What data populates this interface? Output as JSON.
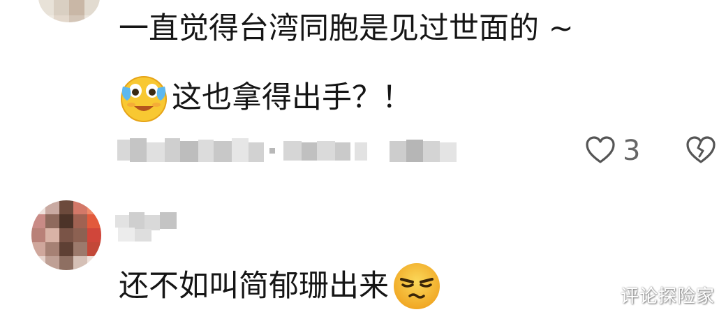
{
  "comments": [
    {
      "avatar": "pixelated-avatar",
      "text_line1": "一直觉得台湾同胞是见过世面的 ~",
      "text_line2": "这也拿得出手？！",
      "emoji_line2": "crying-laughing-emoji",
      "like_count": "3"
    },
    {
      "avatar": "pixelated-avatar",
      "text_line1": "还不如叫简郁珊出来",
      "emoji_line1": "smirking-face-emoji"
    }
  ],
  "icons": {
    "like": "heart-outline-icon",
    "dislike": "broken-heart-icon"
  },
  "watermark": "评论探险家",
  "colors": {
    "text": "#151515",
    "meta": "#666666",
    "emoji_yellow": "#f8c832",
    "emoji_orange": "#f2a21a"
  }
}
